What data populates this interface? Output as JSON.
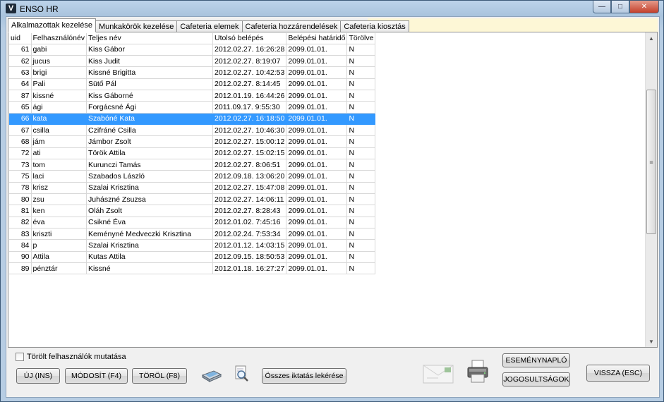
{
  "window": {
    "title": "ENSO HR",
    "icon_letter": "V",
    "minimize": "—",
    "maximize": "□",
    "close": "✕"
  },
  "tabs": [
    {
      "label": "Alkalmazottak kezelése",
      "active": true
    },
    {
      "label": "Munkakörök kezelése",
      "active": false
    },
    {
      "label": "Cafeteria elemek",
      "active": false
    },
    {
      "label": "Cafeteria hozzárendelések",
      "active": false
    },
    {
      "label": "Cafeteria kiosztás",
      "active": false
    }
  ],
  "grid": {
    "columns": [
      "uid",
      "Felhasználónév",
      "Teljes név",
      "Utolsó belépés",
      "Belépési határidő",
      "Törölve"
    ],
    "selected_index": 6,
    "rows": [
      [
        "61",
        "gabi",
        "Kiss Gábor",
        "2012.02.27. 16:26:28",
        "2099.01.01.",
        "N"
      ],
      [
        "62",
        "jucus",
        "Kiss Judit",
        "2012.02.27. 8:19:07",
        "2099.01.01.",
        "N"
      ],
      [
        "63",
        "brigi",
        "Kissné Brigitta",
        "2012.02.27. 10:42:53",
        "2099.01.01.",
        "N"
      ],
      [
        "64",
        "Pali",
        "Sütő Pál",
        "2012.02.27. 8:14:45",
        "2099.01.01.",
        "N"
      ],
      [
        "87",
        "kissné",
        "Kiss Gáborné",
        "2012.01.19. 16:44:26",
        "2099.01.01.",
        "N"
      ],
      [
        "65",
        "ági",
        "Forgácsné Ági",
        "2011.09.17. 9:55:30",
        "2099.01.01.",
        "N"
      ],
      [
        "66",
        "kata",
        "Szabóné Kata",
        "2012.02.27. 16:18:50",
        "2099.01.01.",
        "N"
      ],
      [
        "67",
        "csilla",
        "Czifráné Csilla",
        "2012.02.27. 10:46:30",
        "2099.01.01.",
        "N"
      ],
      [
        "68",
        "jám",
        "Jámbor Zsolt",
        "2012.02.27. 15:00:12",
        "2099.01.01.",
        "N"
      ],
      [
        "72",
        "ati",
        "Török Attila",
        "2012.02.27. 15:02:15",
        "2099.01.01.",
        "N"
      ],
      [
        "73",
        "tom",
        "Kurunczi Tamás",
        "2012.02.27. 8:06:51",
        "2099.01.01.",
        "N"
      ],
      [
        "75",
        "laci",
        "Szabados László",
        "2012.09.18. 13:06:20",
        "2099.01.01.",
        "N"
      ],
      [
        "78",
        "krisz",
        "Szalai Krisztina",
        "2012.02.27. 15:47:08",
        "2099.01.01.",
        "N"
      ],
      [
        "80",
        "zsu",
        "Juhászné Zsuzsa",
        "2012.02.27. 14:06:11",
        "2099.01.01.",
        "N"
      ],
      [
        "81",
        "ken",
        "Oláh Zsolt",
        "2012.02.27. 8:28:43",
        "2099.01.01.",
        "N"
      ],
      [
        "82",
        "éva",
        "Csikné Éva",
        "2012.01.02. 7:45:16",
        "2099.01.01.",
        "N"
      ],
      [
        "83",
        "kriszti",
        "Keményné Medveczki Krisztina",
        "2012.02.24. 7:53:34",
        "2099.01.01.",
        "N"
      ],
      [
        "84",
        "p",
        "Szalai Krisztina",
        "2012.01.12. 14:03:15",
        "2099.01.01.",
        "N"
      ],
      [
        "90",
        "Attila",
        "Kutas Attila",
        "2012.09.15. 18:50:53",
        "2099.01.01.",
        "N"
      ],
      [
        "89",
        "pénztár",
        "Kissné",
        "2012.01.18. 16:27:27",
        "2099.01.01.",
        "N"
      ]
    ]
  },
  "show_deleted": {
    "label": "Törölt felhasználók mutatása",
    "checked": false
  },
  "buttons": {
    "new": "ÚJ (INS)",
    "modify": "MÓDOSÍT (F4)",
    "delete": "TÖRÖL (F8)",
    "all_filings": "Összes iktatás lekérése",
    "event_log": "ESEMÉNYNAPLÓ",
    "permissions": "JOGOSULTSÁGOK",
    "back": "VISSZA (ESC)"
  },
  "icons": [
    "scanner-icon",
    "magnifier-icon",
    "envelope-icon",
    "printer-icon"
  ]
}
